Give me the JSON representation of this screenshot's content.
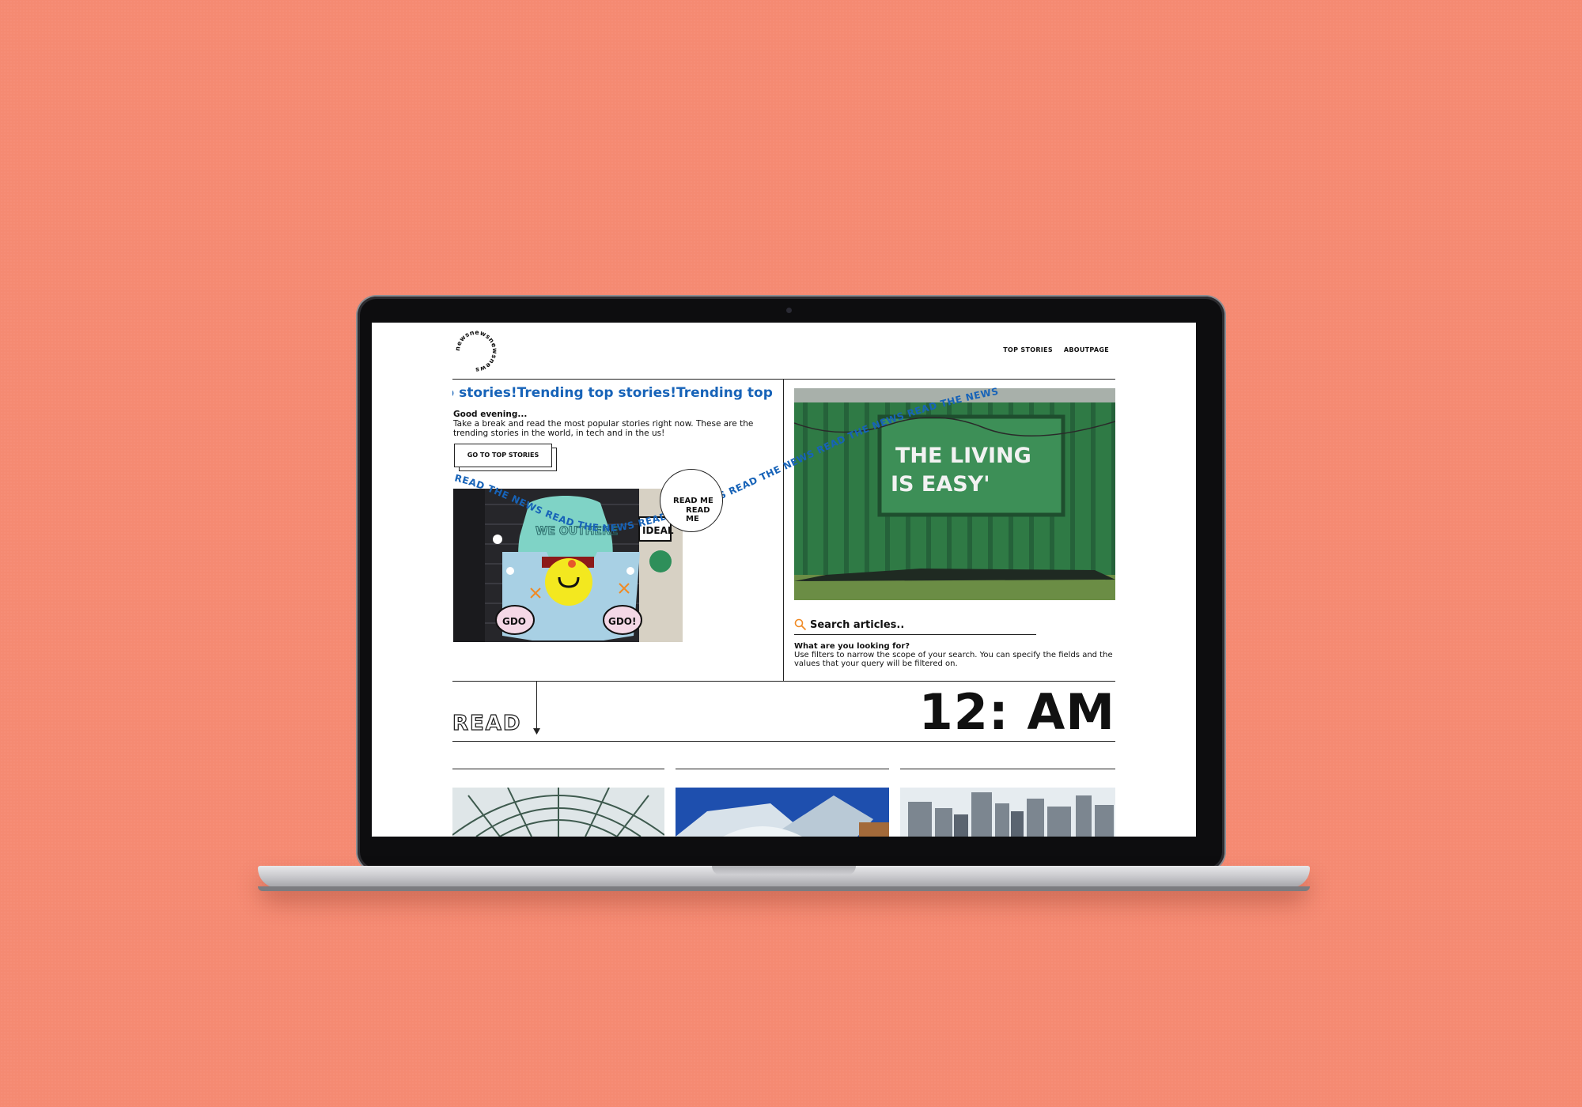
{
  "site": {
    "wordmark": "newsnewsnewsnews",
    "nav": [
      {
        "label": "TOP STORIES"
      },
      {
        "label": "ABOUTPAGE"
      }
    ]
  },
  "hero": {
    "ticker": "p stories!Trending top stories!Trending top s",
    "greeting": "Good evening...",
    "intro": "Take a break and read the most popular stories right now. These are the trending stories in the world, in tech and in the us!",
    "cta_label": "GO TO TOP STORIES",
    "readme_line1": "READ ME",
    "readme_line2": "READ ME",
    "curved_text": "READ THE NEWS READ THE NEWS READ THE NEWS READ THE NEWS READ THE NEWS READ THE NEWS",
    "art_sign": "IDEAL",
    "art_wall_text": "WE OUTHERE",
    "art_left_bubble": "GDO",
    "art_right_bubble": "GDO!",
    "banner_line1": "THE LIVING",
    "banner_line2": "IS EASY'"
  },
  "search": {
    "placeholder": "Search articles..",
    "question": "What are you looking for?",
    "help": "Use filters to narrow the scope of your search. You can specify the fields and the values that your query will be filtered on."
  },
  "section": {
    "read_label": "READ",
    "clock": "12: AM"
  },
  "thumbnails": [
    {
      "subject": "glass-dome"
    },
    {
      "subject": "modern-building"
    },
    {
      "subject": "city-skyline"
    }
  ],
  "colors": {
    "background": "#f58a72",
    "accent_blue": "#1763b8",
    "container_green": "#2d6b3e"
  }
}
